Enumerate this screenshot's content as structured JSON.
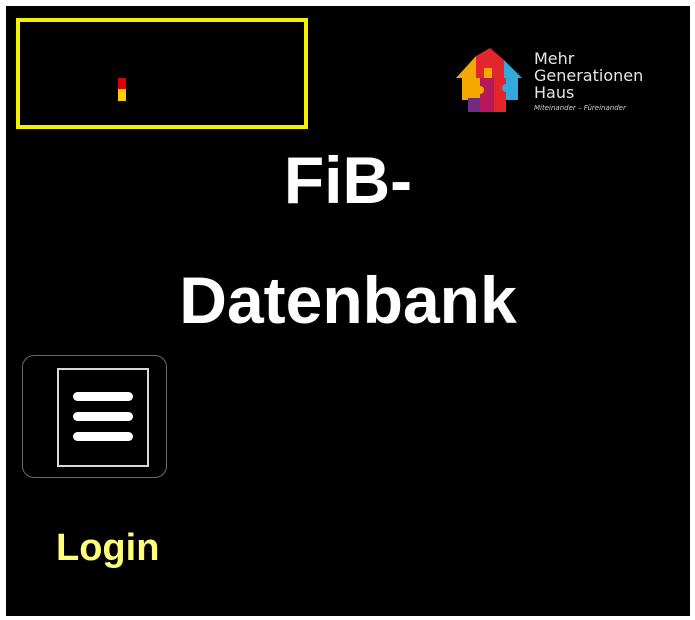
{
  "header": {
    "left_logo": {
      "icon": "german-flag-icon",
      "colors": [
        "#000000",
        "#dd0000",
        "#ffce00"
      ],
      "border_color": "#f2f200"
    },
    "right_logo": {
      "icon": "mehrgenerationenhaus-house-icon",
      "lines": [
        "Mehr",
        "Generationen",
        "Haus"
      ],
      "tagline": "Miteinander – Füreinander"
    }
  },
  "title": {
    "line1": "FiB-",
    "line2": "Datenbank"
  },
  "nav": {
    "menu_icon": "hamburger-menu-icon",
    "login_label": "Login"
  },
  "colors": {
    "background": "#000000",
    "title": "#ffffff",
    "login": "#ffff77",
    "focus_outline": "#f2f200"
  }
}
